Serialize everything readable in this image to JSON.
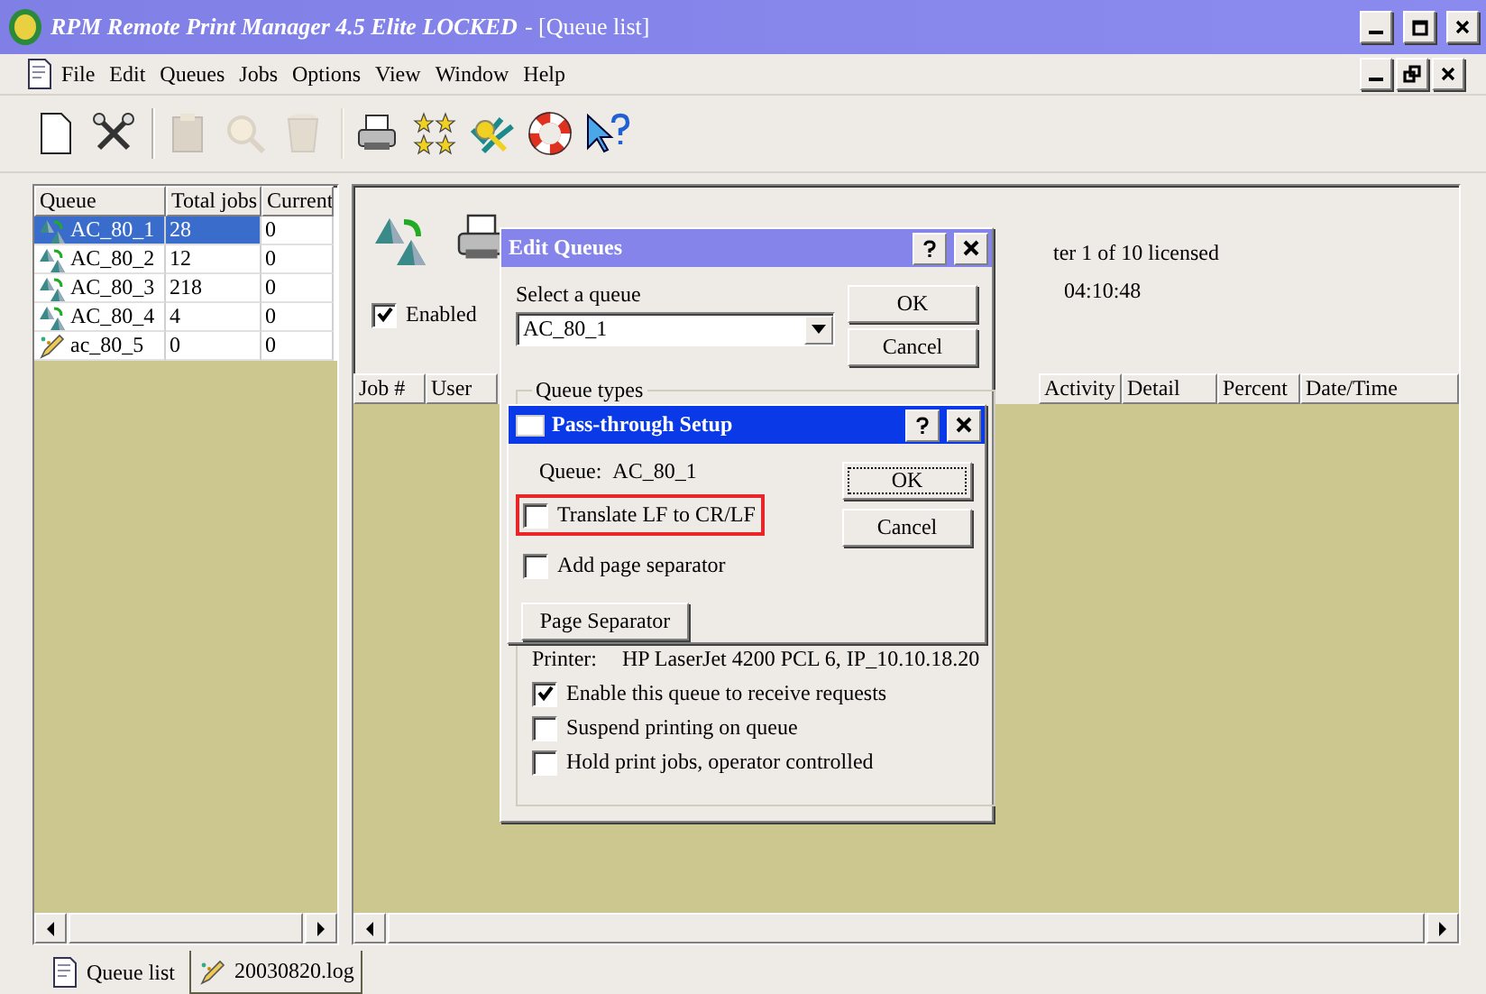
{
  "window": {
    "title": "RPM Remote Print Manager 4.5 Elite LOCKED",
    "document": "- [Queue list]"
  },
  "menu": [
    "File",
    "Edit",
    "Queues",
    "Jobs",
    "Options",
    "View",
    "Window",
    "Help"
  ],
  "toolbar": [
    {
      "kind": "new",
      "disabled": false,
      "group_end": false
    },
    {
      "kind": "tools",
      "disabled": false,
      "group_end": true
    },
    {
      "kind": "clipboard",
      "disabled": true,
      "group_end": false
    },
    {
      "kind": "magnifier",
      "disabled": true,
      "group_end": false
    },
    {
      "kind": "trash",
      "disabled": true,
      "group_end": true
    },
    {
      "kind": "printer",
      "disabled": false,
      "group_end": false
    },
    {
      "kind": "stars",
      "disabled": false,
      "group_end": false
    },
    {
      "kind": "key",
      "disabled": false,
      "group_end": false
    },
    {
      "kind": "lifebuoy",
      "disabled": false,
      "group_end": false
    },
    {
      "kind": "help",
      "disabled": false,
      "group_end": false
    }
  ],
  "queue_list": {
    "columns": [
      "Queue",
      "Total jobs",
      "Current"
    ],
    "rows": [
      {
        "kind": "network",
        "name": "AC_80_1",
        "total_jobs": "28",
        "current": "0",
        "selected": true
      },
      {
        "kind": "network",
        "name": "AC_80_2",
        "total_jobs": "12",
        "current": "0",
        "selected": false
      },
      {
        "kind": "network",
        "name": "AC_80_3",
        "total_jobs": "218",
        "current": "0",
        "selected": false
      },
      {
        "kind": "network",
        "name": "AC_80_4",
        "total_jobs": "4",
        "current": "0",
        "selected": false
      },
      {
        "kind": "pen",
        "name": "ac_80_5",
        "total_jobs": "0",
        "current": "0",
        "selected": false
      }
    ]
  },
  "status_panel": {
    "enabled": {
      "label": "Enabled",
      "checked": true
    },
    "license": "ter 1 of 10 licensed",
    "time": "04:10:48"
  },
  "jobs_table": {
    "columns": [
      "Job #",
      "User",
      "Activity",
      "Detail",
      "Percent",
      "Date/Time"
    ]
  },
  "edit_queues": {
    "title": "Edit Queues",
    "select_label": "Select a queue",
    "select_value": "AC_80_1",
    "buttons": [
      "OK",
      "Cancel"
    ],
    "group_label": "Queue types",
    "printer_label": "Printer:",
    "printer_value": "HP LaserJet 4200 PCL 6, IP_10.10.18.20",
    "options": [
      {
        "label": "Enable this queue to receive requests",
        "checked": true
      },
      {
        "label": "Suspend printing on queue",
        "checked": false
      },
      {
        "label": "Hold print jobs, operator controlled",
        "checked": false
      }
    ]
  },
  "pass_through": {
    "title": "Pass-through Setup",
    "queue_label": "Queue:",
    "queue_value": "AC_80_1",
    "options": [
      {
        "label": "Translate LF to CR/LF",
        "checked": false,
        "highlighted": true
      },
      {
        "label": "Add page separator",
        "checked": false,
        "highlighted": false
      }
    ],
    "page_separator_button": "Page Separator",
    "buttons": [
      {
        "label": "OK",
        "focused": true
      },
      {
        "label": "Cancel",
        "focused": false
      }
    ]
  },
  "tabs": [
    {
      "label": "Queue list",
      "selected": true
    },
    {
      "label": "20030820.log",
      "selected": false
    }
  ]
}
